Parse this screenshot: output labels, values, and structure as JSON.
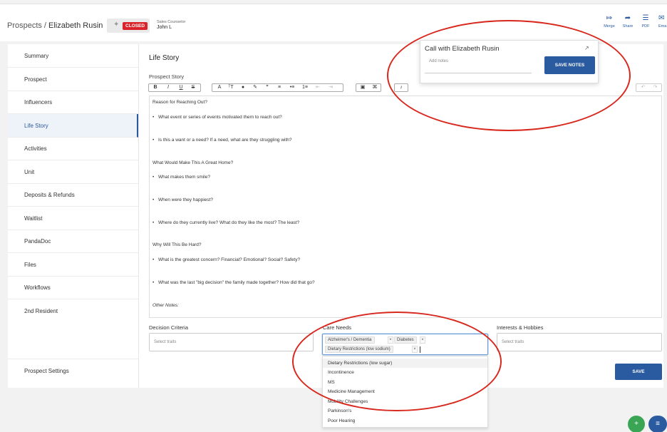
{
  "breadcrumb": {
    "root": "Prospects",
    "separator": "/",
    "current": "Elizabeth Rusin"
  },
  "status": {
    "badge": "CLOSED",
    "spark_icon": "sparkle-icon"
  },
  "counselor": {
    "label": "Sales Counselor",
    "value": "John L"
  },
  "header_actions": [
    {
      "label": "Merge",
      "icon": "merge-icon",
      "glyph": "⤇"
    },
    {
      "label": "Share",
      "icon": "share-icon",
      "glyph": "➦"
    },
    {
      "label": "PDF",
      "icon": "pdf-icon",
      "glyph": "☰"
    },
    {
      "label": "Ema",
      "icon": "email-icon",
      "glyph": "✉"
    }
  ],
  "sidebar": {
    "items": [
      {
        "label": "Summary"
      },
      {
        "label": "Prospect"
      },
      {
        "label": "Influencers"
      },
      {
        "label": "Life Story",
        "active": true
      },
      {
        "label": "Activities"
      },
      {
        "label": "Unit"
      },
      {
        "label": "Deposits & Refunds"
      },
      {
        "label": "Waitlist"
      },
      {
        "label": "PandaDoc"
      },
      {
        "label": "Files"
      },
      {
        "label": "Workflows"
      },
      {
        "label": "2nd Resident"
      }
    ],
    "settings_label": "Prospect Settings"
  },
  "main": {
    "title": "Life Story",
    "editor_label": "Prospect Story",
    "toolbar": {
      "bold": "B",
      "italic": "I",
      "underline": "U",
      "strike": "S",
      "font_color": "A",
      "font_size": "ᵀT",
      "color_picker": "●",
      "highlight": "✎",
      "quote": "”",
      "align": "≡",
      "bullets": "•≡",
      "numbers": "1≡",
      "indent_less": "⇤",
      "indent_more": "⇥",
      "image": "▣",
      "link": "⌘",
      "mic": "♪",
      "undo": "↶",
      "redo": "↷"
    },
    "story_lines": [
      {
        "text": "Reason for Reaching Out?",
        "style": "plain"
      },
      {
        "text": "What event or series of events motivated them to reach out?",
        "style": "bullet"
      },
      {
        "text": "Is this a want or a need?  If a need, what are they struggling with?",
        "style": "bullet"
      },
      {
        "text": "What Would Make This A Great Home?",
        "style": "plain"
      },
      {
        "text": "What makes them smile?",
        "style": "bullet"
      },
      {
        "text": "When were they happiest?",
        "style": "bullet"
      },
      {
        "text": "Where do they currently live?  What do they like the most?  The least?",
        "style": "bullet"
      },
      {
        "text": "Why Will This Be Hard?",
        "style": "plain"
      },
      {
        "text": "What is the greatest concern?  Financial?  Emotional?  Social?  Safety?",
        "style": "bullet"
      },
      {
        "text": "What was the last \"big decision\" the family made together?  How did that go?",
        "style": "bullet"
      },
      {
        "text": "Other Notes:",
        "style": "italic"
      }
    ],
    "decision_criteria": {
      "label": "Decision Criteria",
      "placeholder": "Select traits"
    },
    "care_needs": {
      "label": "Care Needs",
      "selected": [
        "Alzheimer's / Dementia",
        "Diabetes",
        "Dietary Restrictions (low sodium)"
      ],
      "options": [
        "Dietary Restrictions (low sugar)",
        "Incontinence",
        "MS",
        "Medicine Management",
        "Mobility Challenges",
        "Parkinson's",
        "Poor Hearing"
      ]
    },
    "interests": {
      "label": "Interests & Hobbies",
      "placeholder": "Select traits"
    },
    "save_label": "SAVE"
  },
  "call_popup": {
    "title": "Call with Elizabeth Rusin",
    "external_icon": "external-link-icon",
    "notes_placeholder": "Add notes",
    "save_label": "SAVE NOTES"
  },
  "fabs": [
    {
      "icon": "add-user-icon",
      "glyph": "+",
      "color": "#3aa655"
    },
    {
      "icon": "checklist-icon",
      "glyph": "≡",
      "color": "#2a5aa0"
    }
  ],
  "colors": {
    "accent": "#2a5aa0",
    "closed_badge": "#d9222a",
    "annotation": "#d8281e"
  }
}
